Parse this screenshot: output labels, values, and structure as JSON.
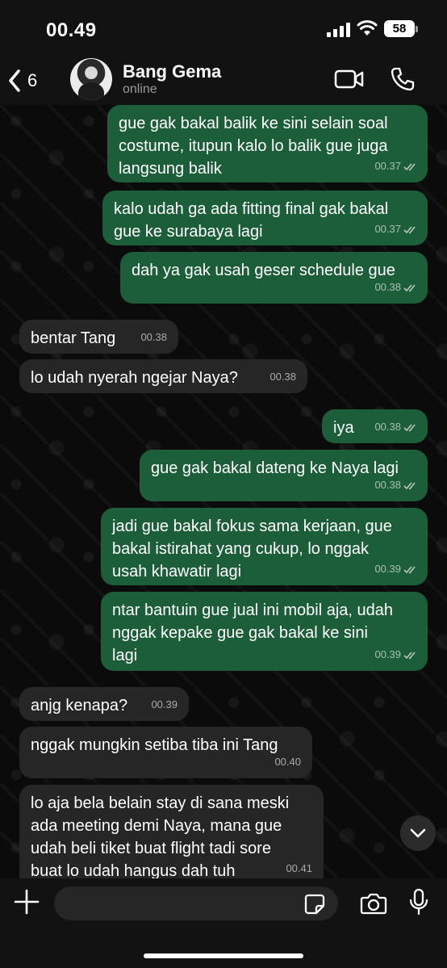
{
  "status_bar": {
    "time": "00.49",
    "battery": "58"
  },
  "header": {
    "back_count": "6",
    "contact_name": "Bang Gema",
    "contact_status": "online"
  },
  "messages": [
    {
      "dir": "out",
      "text": "gue gak bakal balik ke sini selain soal\ncostume, itupun kalo lo balik gue juga\nlangsung balik",
      "time": "00.37",
      "read": true
    },
    {
      "dir": "out",
      "text": "kalo udah ga ada fitting final gak bakal\ngue ke surabaya lagi",
      "time": "00.37",
      "read": true
    },
    {
      "dir": "out",
      "text": "dah ya gak usah geser schedule gue",
      "time": "00.38",
      "read": true
    },
    {
      "dir": "in",
      "text": "bentar Tang",
      "time": "00.38"
    },
    {
      "dir": "in",
      "text": "lo udah nyerah ngejar Naya?",
      "time": "00.38"
    },
    {
      "dir": "out",
      "text": "iya",
      "time": "00.38",
      "read": true
    },
    {
      "dir": "out",
      "text": "gue gak bakal dateng ke Naya lagi",
      "time": "00.38",
      "read": true
    },
    {
      "dir": "out",
      "text": "jadi gue bakal fokus sama kerjaan, gue\nbakal istirahat yang cukup, lo nggak\nusah khawatir lagi",
      "time": "00.39",
      "read": true
    },
    {
      "dir": "out",
      "text": "ntar bantuin gue jual ini mobil aja, udah\nnggak kepake gue gak bakal ke sini\nlagi",
      "time": "00.39",
      "read": true
    },
    {
      "dir": "in",
      "text": "anjg kenapa?",
      "time": "00.39"
    },
    {
      "dir": "in",
      "text": "nggak mungkin setiba tiba ini Tang",
      "time": "00.40"
    },
    {
      "dir": "in",
      "text": "lo aja bela belain stay di sana meski\nada meeting demi Naya, mana gue\nudah beli tiket buat flight tadi sore\nbuat lo udah hangus dah tuh",
      "time": "00.41"
    }
  ],
  "colors": {
    "outgoing_bubble": "#1c5e3a",
    "incoming_bubble": "#262626",
    "background": "#0b0b0b"
  },
  "icons": [
    "back-chevron-icon",
    "video-call-icon",
    "phone-icon",
    "chevron-down-icon",
    "plus-icon",
    "sticker-icon",
    "camera-icon",
    "microphone-icon"
  ]
}
